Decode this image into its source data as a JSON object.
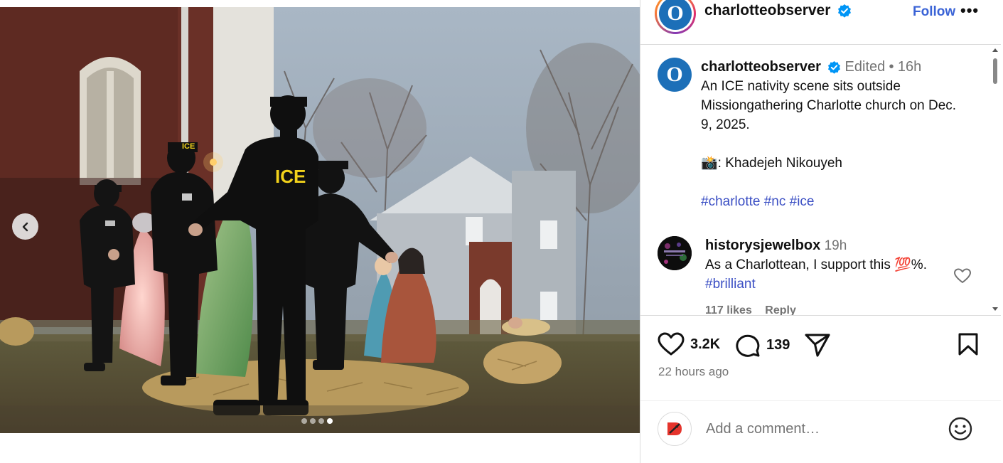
{
  "post_media": {
    "carousel_index": 4,
    "carousel_total": 4,
    "vest_text": "ICE",
    "prev_icon": "chevron-left-icon"
  },
  "header": {
    "username": "charlotteobserver",
    "logo_letter": "O",
    "follow_label": "Follow",
    "more_label": "•••"
  },
  "caption": {
    "username": "charlotteobserver",
    "edited": "Edited",
    "separator": "•",
    "age": "16h",
    "text": "An ICE nativity scene sits outside Missiongathering Charlotte church on Dec. 9, 2025.",
    "credit": "📸: Khadejeh Nikouyeh",
    "hashtags": "#charlotte #nc #ice"
  },
  "comment": {
    "username": "historysjewelbox",
    "age": "19h",
    "text": "As a Charlottean, I support this 💯%.",
    "hashtag": "#brilliant",
    "likes": "117 likes",
    "reply": "Reply",
    "avatar_text": "HISTORY'S JEWEL BOX"
  },
  "actions": {
    "likes_count": "3.2K",
    "comments_count": "139",
    "timestamp": "22 hours ago"
  },
  "add_comment": {
    "placeholder": "Add a comment…"
  },
  "colors": {
    "link": "#3b4fc4",
    "follow": "#3a63d6",
    "verified": "#0095f6",
    "brand": "#1c6fb8",
    "vest_text": "#f2d21b"
  }
}
